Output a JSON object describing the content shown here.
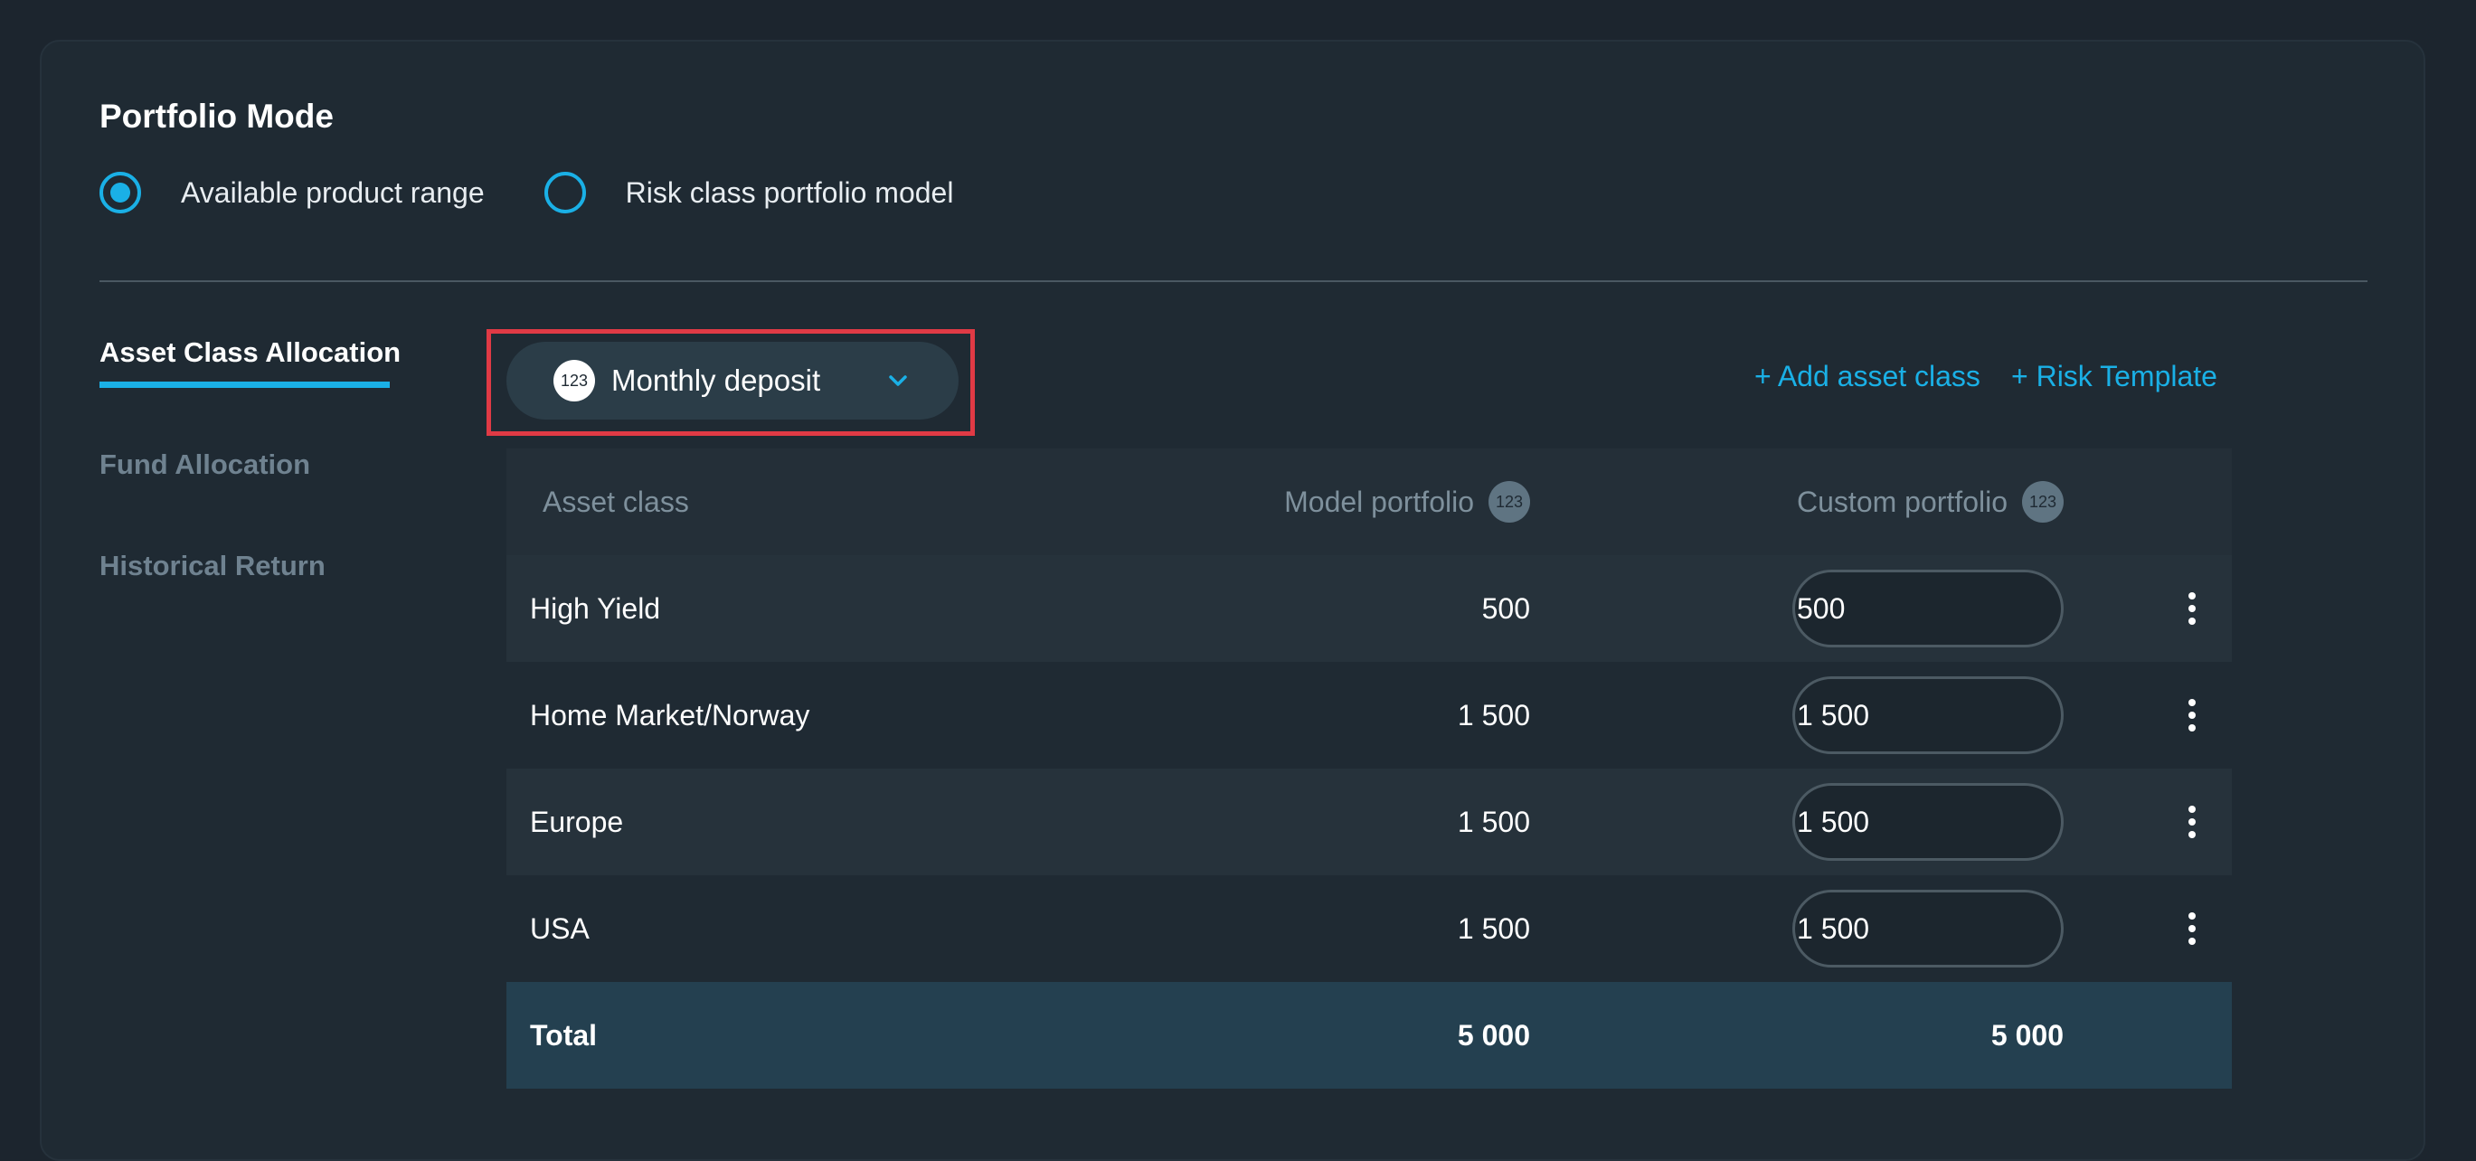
{
  "portfolio_mode": {
    "title": "Portfolio Mode",
    "options": [
      {
        "label": "Available product range",
        "selected": true
      },
      {
        "label": "Risk class portfolio model",
        "selected": false
      }
    ]
  },
  "side_nav": {
    "items": [
      {
        "label": "Asset Class Allocation",
        "active": true
      },
      {
        "label": "Fund Allocation",
        "active": false
      },
      {
        "label": "Historical Return",
        "active": false
      }
    ]
  },
  "toolbar": {
    "dropdown": {
      "badge": "123",
      "label": "Monthly deposit",
      "icon": "chevron-down-icon"
    },
    "add_asset_class": "+ Add asset class",
    "risk_template": "+ Risk Template"
  },
  "table": {
    "headers": {
      "asset_class": "Asset class",
      "model_portfolio": "Model portfolio",
      "model_badge": "123",
      "custom_portfolio": "Custom portfolio",
      "custom_badge": "123"
    },
    "rows": [
      {
        "asset_class": "High Yield",
        "model": "500",
        "custom": "500"
      },
      {
        "asset_class": "Home Market/Norway",
        "model": "1 500",
        "custom": "1 500"
      },
      {
        "asset_class": "Europe",
        "model": "1 500",
        "custom": "1 500"
      },
      {
        "asset_class": "USA",
        "model": "1 500",
        "custom": "1 500"
      }
    ],
    "total": {
      "label": "Total",
      "model": "5 000",
      "custom": "5 000"
    }
  },
  "colors": {
    "accent": "#1ab0e6",
    "highlight_border": "#e03a45",
    "background": "#1c252e",
    "card": "#1f2a33",
    "total_row": "#244050"
  }
}
